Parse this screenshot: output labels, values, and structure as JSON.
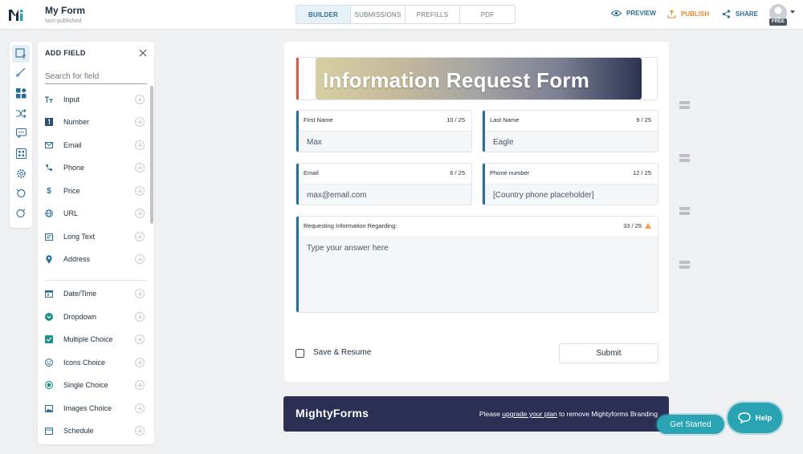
{
  "header": {
    "form_title": "My Form",
    "form_status": "Non-published",
    "tabs": [
      {
        "label": "BUILDER",
        "active": true
      },
      {
        "label": "SUBMISSIONS",
        "active": false
      },
      {
        "label": "PREFILLS",
        "active": false
      },
      {
        "label": "PDF",
        "active": false
      }
    ],
    "actions": {
      "preview": "PREVIEW",
      "publish": "PUBLISH",
      "share": "SHARE"
    },
    "plan_badge": "FREE"
  },
  "colors": {
    "accent": "#2c6d93",
    "publish": "#e08a2c",
    "teal": "#2aa3b2",
    "brand_bar": "#2a2f53",
    "warning": "#f0a14a"
  },
  "icon_strip": [
    {
      "icon": "add-field-icon",
      "active": true
    },
    {
      "icon": "paint-brush-icon",
      "active": false
    },
    {
      "icon": "widgets-icon",
      "active": false
    },
    {
      "icon": "shuffle-icon",
      "active": false
    },
    {
      "icon": "message-icon",
      "active": false
    },
    {
      "icon": "apps-icon",
      "active": false
    },
    {
      "icon": "settings-icon",
      "active": false
    },
    {
      "icon": "undo-icon",
      "active": false
    },
    {
      "icon": "redo-icon",
      "active": false
    }
  ],
  "panel": {
    "title": "ADD FIELD",
    "search_placeholder": "Search for field",
    "fields": [
      {
        "label": "Input",
        "icon": "text-icon"
      },
      {
        "label": "Number",
        "icon": "number-icon"
      },
      {
        "label": "Email",
        "icon": "email-icon"
      },
      {
        "label": "Phone",
        "icon": "phone-icon"
      },
      {
        "label": "Price",
        "icon": "dollar-icon"
      },
      {
        "label": "URL",
        "icon": "globe-icon"
      },
      {
        "label": "Long Text",
        "icon": "long-text-icon"
      },
      {
        "label": "Address",
        "icon": "location-pin-icon"
      },
      {
        "label": "Date/Time",
        "icon": "calendar-icon"
      },
      {
        "label": "Dropdown",
        "icon": "dropdown-icon"
      },
      {
        "label": "Multiple Choice",
        "icon": "checkbox-icon"
      },
      {
        "label": "Icons Choice",
        "icon": "emoji-icon"
      },
      {
        "label": "Single Choice",
        "icon": "radio-icon"
      },
      {
        "label": "Images Choice",
        "icon": "image-icon"
      },
      {
        "label": "Schedule",
        "icon": "schedule-icon"
      }
    ]
  },
  "form": {
    "banner_title": "Information Request Form",
    "fields": {
      "first_name": {
        "label": "First Name",
        "count": "10 / 25",
        "value": "Max"
      },
      "last_name": {
        "label": "Last Name",
        "count": "9 / 25",
        "value": "Eagle"
      },
      "email": {
        "label": "Email",
        "count": "6 / 25",
        "value": "max@email.com"
      },
      "phone": {
        "label": "Phone number",
        "count": "12 / 25",
        "value": "[Country phone placeholder]"
      },
      "request": {
        "label": "Requesting Information Regarding:",
        "count": "33 / 25",
        "placeholder": "Type your answer here"
      }
    },
    "save_resume_label": "Save & Resume",
    "submit_label": "Submit"
  },
  "branding": {
    "logo": "MightyForms",
    "text_pre": "Please ",
    "link": "upgrade your plan",
    "text_post": " to remove Mightyforms Branding"
  },
  "get_started_label": "Get Started",
  "help_label": "Help"
}
